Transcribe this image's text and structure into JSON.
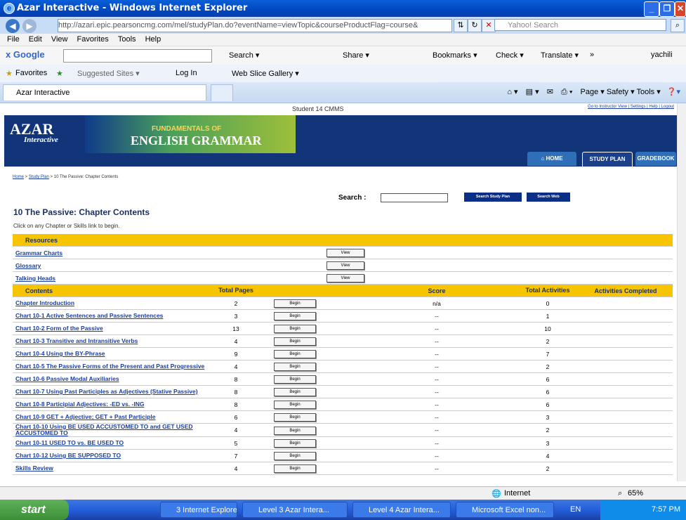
{
  "window": {
    "title": "Azar Interactive - Windows Internet Explorer"
  },
  "address": {
    "url": "http://azari.epic.pearsoncmg.com/mel/studyPlan.do?eventName=viewTopic&courseProductFlag=course&",
    "search_placeholder": "Yahoo! Search"
  },
  "menu": [
    "File",
    "Edit",
    "View",
    "Favorites",
    "Tools",
    "Help"
  ],
  "google": {
    "brand": "x Google",
    "items": [
      "Search ▾",
      "Share ▾",
      "Bookmarks ▾",
      "Check ▾",
      "Translate ▾",
      "»",
      "yachili"
    ]
  },
  "favorites": {
    "label": "Favorites",
    "items": [
      "Suggested Sites ▾",
      "Log In",
      "Web Slice Gallery ▾"
    ]
  },
  "tab": {
    "title": "Azar Interactive"
  },
  "cmdbar": "Page ▾  Safety ▾  Tools ▾",
  "site": {
    "student": "Student 14 CMMS",
    "toplinks": "Go to Instructor View |  Settings |  Help |  Logout",
    "logo": "AZAR",
    "logo_sub": "Interactive",
    "fund": "FUNDAMENTALS OF",
    "english": "ENGLISH GRAMMAR",
    "tabs": [
      "⌂ HOME",
      "STUDY PLAN",
      "GRADEBOOK"
    ],
    "breadcrumb": {
      "home": "Home",
      "study": "Study Plan",
      "rest": " > 10 The Passive: Chapter Contents"
    },
    "search_label": "Search :",
    "search_study": "Search Study Plan",
    "search_web": "Search Web",
    "title": "10 The Passive: Chapter Contents",
    "instruction": "Click on any Chapter or Skills link to begin.",
    "resources_header": "Resources",
    "resources": [
      "Grammar Charts",
      "Glossary",
      "Talking Heads"
    ],
    "view_label": "View",
    "begin_label": "Begin",
    "headers": {
      "contents": "Contents",
      "pages": "Total Pages",
      "score": "Score",
      "activities": "Total Activities",
      "completed": "Activities Completed"
    },
    "rows": [
      {
        "name": "Chapter Introduction",
        "pages": "2",
        "score": "n/a",
        "acts": "0"
      },
      {
        "name": "Chart 10-1 Active Sentences and Passive Sentences",
        "pages": "3",
        "score": "--",
        "acts": "1"
      },
      {
        "name": "Chart 10-2 Form of the Passive",
        "pages": "13",
        "score": "--",
        "acts": "10"
      },
      {
        "name": "Chart 10-3 Transitive and Intransitive Verbs",
        "pages": "4",
        "score": "--",
        "acts": "2"
      },
      {
        "name": "Chart 10-4 Using the BY-Phrase",
        "pages": "9",
        "score": "--",
        "acts": "7"
      },
      {
        "name": "Chart 10-5 The Passive Forms of the Present and Past Progressive",
        "pages": "4",
        "score": "--",
        "acts": "2"
      },
      {
        "name": "Chart 10-6 Passive Modal Auxiliaries",
        "pages": "8",
        "score": "--",
        "acts": "6"
      },
      {
        "name": "Chart 10-7 Using Past Participles as Adjectives (Stative Passive)",
        "pages": "8",
        "score": "--",
        "acts": "6"
      },
      {
        "name": "Chart 10-8 Participial Adjectives: -ED vs. -ING",
        "pages": "8",
        "score": "--",
        "acts": "6"
      },
      {
        "name": "Chart 10-9 GET + Adjective; GET + Past Participle",
        "pages": "6",
        "score": "--",
        "acts": "3"
      },
      {
        "name": "Chart 10-10 Using BE USED ACCUSTOMED TO and GET USED ACCUSTOMED TO",
        "pages": "4",
        "score": "--",
        "acts": "2"
      },
      {
        "name": "Chart 10-11 USED TO vs. BE USED TO",
        "pages": "5",
        "score": "--",
        "acts": "3"
      },
      {
        "name": "Chart 10-12 Using BE SUPPOSED TO",
        "pages": "7",
        "score": "--",
        "acts": "4"
      },
      {
        "name": "Skills Review",
        "pages": "4",
        "score": "--",
        "acts": "2"
      }
    ]
  },
  "status": {
    "zone": "Internet",
    "zoom": "65%"
  },
  "taskbar": {
    "start": "start",
    "tasks": [
      "3 Internet Explorer",
      "Level 3 Azar Intera...",
      "Level 4 Azar Intera...",
      "Microsoft Excel non..."
    ],
    "lang": "EN",
    "time": "7:57 PM"
  }
}
